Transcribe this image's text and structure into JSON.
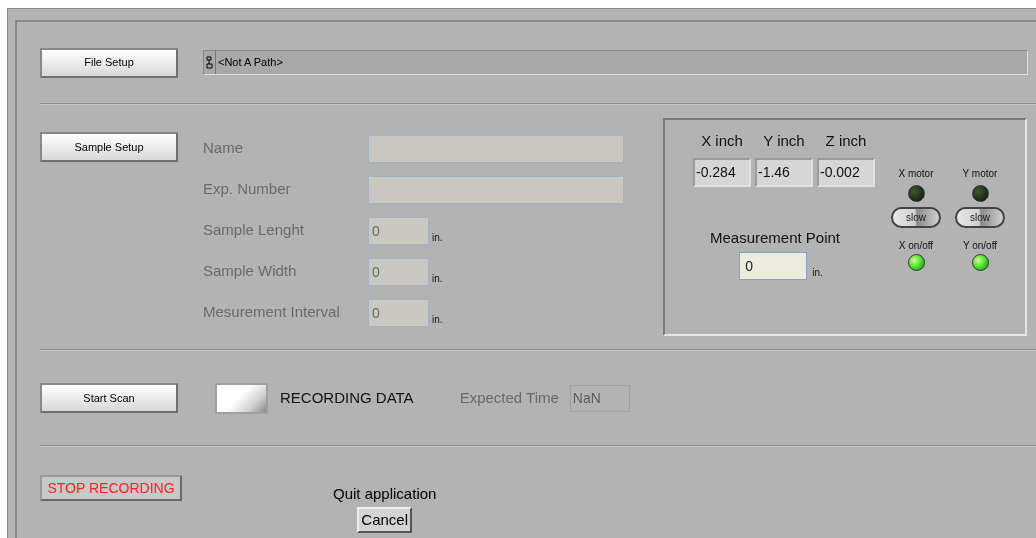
{
  "file_setup": {
    "button": "File Setup",
    "path": "<Not A Path>"
  },
  "sample_setup": {
    "button": "Sample Setup",
    "fields": [
      {
        "label": "Name",
        "kind": "text",
        "disabled": true
      },
      {
        "label": "Exp. Number",
        "kind": "text",
        "disabled": true
      },
      {
        "label": "Sample Lenght",
        "kind": "number",
        "value": "0",
        "unit": "in.",
        "disabled": true
      },
      {
        "label": "Sample Width",
        "kind": "number",
        "value": "0",
        "unit": "in.",
        "disabled": true
      },
      {
        "label": "Mesurement Interval",
        "kind": "number",
        "value": "0",
        "unit": "in.",
        "disabled": true
      }
    ]
  },
  "position": {
    "axes": [
      {
        "label": "X inch",
        "value": "-0.284"
      },
      {
        "label": "Y inch",
        "value": "-1.46"
      },
      {
        "label": "Z inch",
        "value": "-0.002"
      }
    ],
    "measurement_point": {
      "label": "Measurement Point",
      "value": "0",
      "unit": "in."
    },
    "motors": [
      {
        "label": "X motor",
        "on": false,
        "switch": "slow",
        "switch_on": false,
        "enable_label": "X on/off",
        "enabled": true
      },
      {
        "label": "Y motor",
        "on": false,
        "switch": "slow",
        "switch_on": false,
        "enable_label": "Y on/off",
        "enabled": true
      }
    ]
  },
  "scan": {
    "button": "Start Scan",
    "recording": {
      "label": "RECORDING DATA",
      "on": false
    },
    "expected_time": {
      "label": "Expected Time",
      "value": "NaN",
      "disabled": true
    }
  },
  "stop_button": "STOP RECORDING",
  "quit": {
    "label": "Quit application",
    "button": "Cancel"
  }
}
